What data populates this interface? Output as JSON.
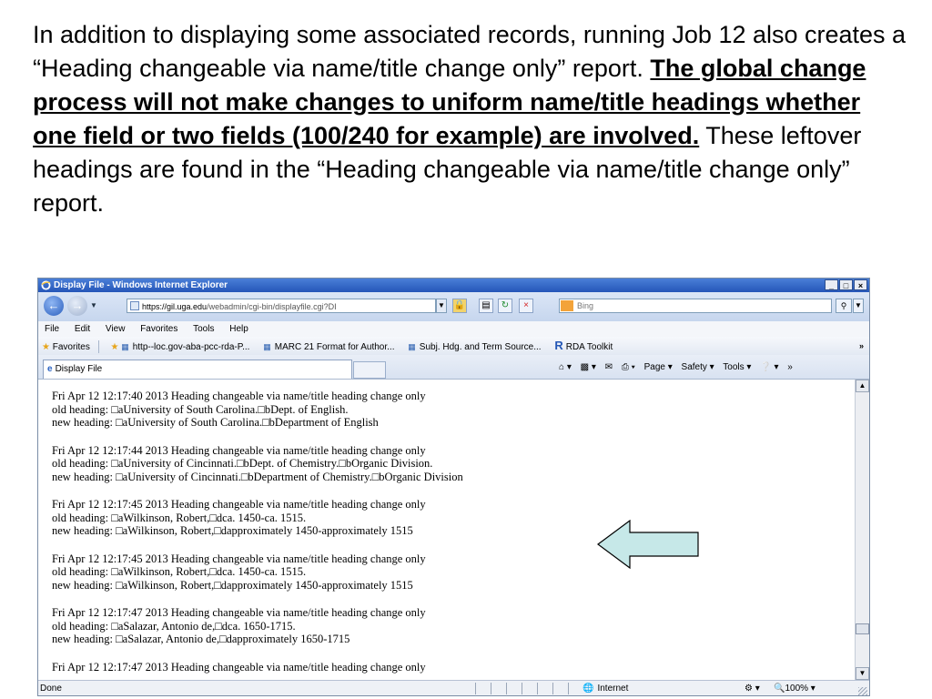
{
  "slide": {
    "text_before": "In addition to displaying some associated records, running Job 12 also creates a “Heading changeable via name/title change only” report.  ",
    "text_emphasis": "The global change process will not make changes to uniform name/title headings whether one field or two fields (100/240 for example) are involved.",
    "text_after": " These leftover headings are found in the “Heading changeable via name/title change only” report."
  },
  "browser": {
    "title": "Display File - Windows Internet Explorer",
    "window_buttons": {
      "minimize": "_",
      "maximize": "□",
      "close": "×"
    },
    "url_host": "https://gil.uga.edu",
    "url_rest": "/webadmin/cgi-bin/displayfile.cgi?DI",
    "search_placeholder": "Bing",
    "menu": [
      "File",
      "Edit",
      "View",
      "Favorites",
      "Tools",
      "Help"
    ],
    "favorites_label": "Favorites",
    "favorites": [
      "http--loc.gov-aba-pcc-rda-P...",
      "MARC 21 Format for Author...",
      "Subj. Hdg. and Term Source...",
      "RDA Toolkit"
    ],
    "tab_label": "Display File",
    "command_bar": [
      "Page ▾",
      "Safety ▾",
      "Tools ▾"
    ],
    "status_done": "Done",
    "status_zone": "Internet",
    "status_zoom": "100%"
  },
  "report": {
    "entries": [
      {
        "line1": "Fri Apr 12 12:17:40 2013 Heading changeable via name/title heading change only",
        "line2": "old heading: □aUniversity of South Carolina.□bDept. of English.",
        "line3": "new heading: □aUniversity of South Carolina.□bDepartment of English"
      },
      {
        "line1": "Fri Apr 12 12:17:44 2013 Heading changeable via name/title heading change only",
        "line2": "old heading: □aUniversity of Cincinnati.□bDept. of Chemistry.□bOrganic Division.",
        "line3": "new heading: □aUniversity of Cincinnati.□bDepartment of Chemistry.□bOrganic Division"
      },
      {
        "line1": "Fri Apr 12 12:17:45 2013 Heading changeable via name/title heading change only",
        "line2": "old heading: □aWilkinson, Robert,□dca. 1450-ca. 1515.",
        "line3": "new heading: □aWilkinson, Robert,□dapproximately 1450-approximately 1515"
      },
      {
        "line1": "Fri Apr 12 12:17:45 2013 Heading changeable via name/title heading change only",
        "line2": "old heading: □aWilkinson, Robert,□dca. 1450-ca. 1515.",
        "line3": "new heading: □aWilkinson, Robert,□dapproximately 1450-approximately 1515"
      },
      {
        "line1": "Fri Apr 12 12:17:47 2013 Heading changeable via name/title heading change only",
        "line2": "old heading: □aSalazar, Antonio de,□dca. 1650-1715.",
        "line3": "new heading: □aSalazar, Antonio de,□dapproximately 1650-1715"
      },
      {
        "line1": "Fri Apr 12 12:17:47 2013 Heading changeable via name/title heading change only",
        "line2": "",
        "line3": ""
      }
    ]
  },
  "colors": {
    "titlebar": "#2556b8",
    "arrow_fill": "#c6e8e8",
    "arrow_stroke": "#000000"
  }
}
